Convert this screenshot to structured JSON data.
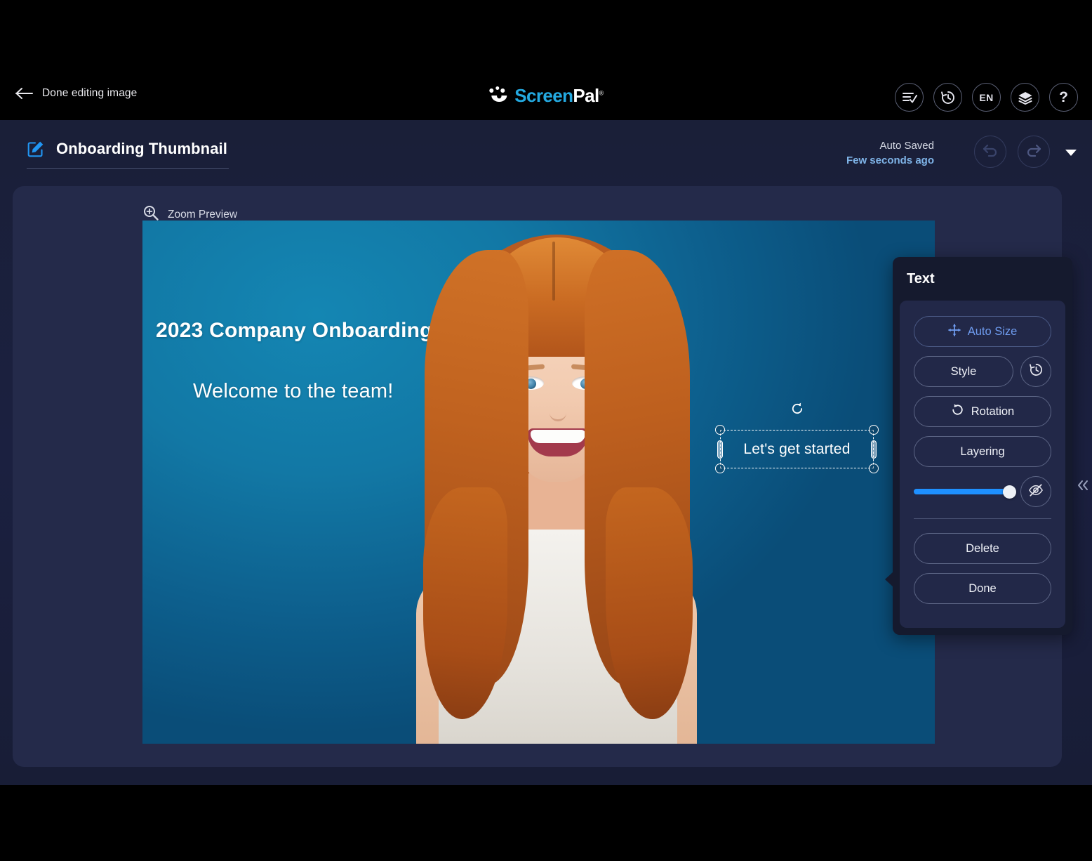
{
  "topbar": {
    "back_label": "Done editing image",
    "back_icon": "arrow-left-icon",
    "brand_name_a": "Screen",
    "brand_name_b": "Pal",
    "brand_registered": "®",
    "brand_logo_icon": "screenpal-logo-icon",
    "icons": [
      {
        "name": "checklist-icon",
        "label": ""
      },
      {
        "name": "history-clock-icon",
        "label": ""
      },
      {
        "name": "language-icon",
        "label": "EN"
      },
      {
        "name": "layers-icon",
        "label": ""
      },
      {
        "name": "help-question-icon",
        "label": "?"
      }
    ]
  },
  "project": {
    "title": "Onboarding Thumbnail",
    "edit_icon": "edit-pencil-square-icon",
    "autosave_status": "Auto Saved",
    "autosave_time": "Few seconds ago",
    "undo_icon": "undo-arrow-icon",
    "redo_icon": "redo-arrow-icon",
    "more_caret_icon": "caret-down-icon"
  },
  "canvas": {
    "zoom_preview_label": "Zoom Preview",
    "zoom_preview_icon": "magnifier-plus-icon",
    "image": {
      "headline": "2023 Company Onboarding",
      "subheadline": "Welcome to the team!",
      "background_color": "#12789f",
      "alt_subject": "smiling woman with long red hair in white sleeveless top"
    },
    "selected_text_object": {
      "value": "Let's get started",
      "rotate_handle_icon": "rotate-icon",
      "handles": [
        "top-left",
        "top-right",
        "bottom-left",
        "bottom-right",
        "left-middle",
        "right-middle"
      ]
    }
  },
  "text_panel": {
    "title": "Text",
    "auto_size_label": "Auto Size",
    "auto_size_icon": "move-arrows-icon",
    "style_label": "Style",
    "style_history_icon": "history-clock-icon",
    "rotation_label": "Rotation",
    "rotation_icon": "rotate-cw-icon",
    "layering_label": "Layering",
    "opacity_value": "96",
    "visibility_icon": "eye-off-icon",
    "delete_label": "Delete",
    "done_label": "Done",
    "accent_color": "#6f9cf0",
    "slider_color": "#1e90ff"
  },
  "collapse_panel_icon": "chevron-double-left-icon"
}
